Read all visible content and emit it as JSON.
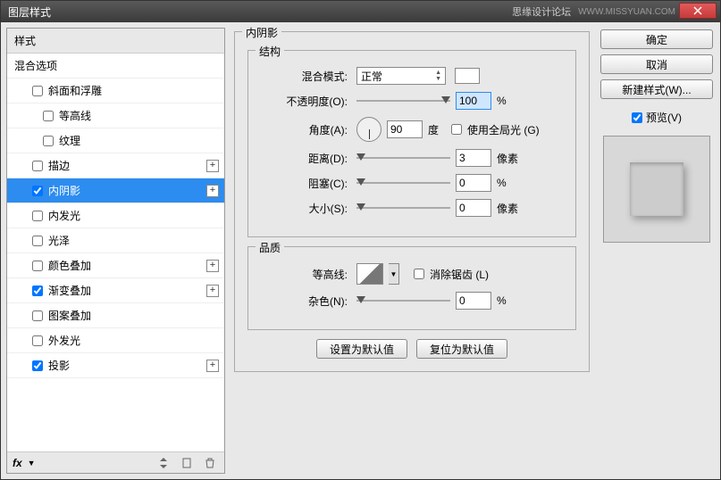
{
  "window": {
    "title": "图层样式",
    "brand": "思缘设计论坛",
    "url": "WWW.MISSYUAN.COM"
  },
  "styles": {
    "header": "样式",
    "blendOptions": "混合选项",
    "bevelEmboss": "斜面和浮雕",
    "contour": "等高线",
    "texture": "纹理",
    "stroke": "描边",
    "innerShadow": "内阴影",
    "innerGlow": "内发光",
    "satin": "光泽",
    "colorOverlay": "颜色叠加",
    "gradientOverlay": "渐变叠加",
    "patternOverlay": "图案叠加",
    "outerGlow": "外发光",
    "dropShadow": "投影"
  },
  "panel": {
    "title": "内阴影",
    "structure": "结构",
    "blendMode": "混合模式:",
    "blendModeValue": "正常",
    "opacity": "不透明度(O):",
    "opacityValue": "100",
    "opacityUnit": "%",
    "angle": "角度(A):",
    "angleValue": "90",
    "angleUnit": "度",
    "useGlobal": "使用全局光 (G)",
    "distance": "距离(D):",
    "distanceValue": "3",
    "distanceUnit": "像素",
    "choke": "阻塞(C):",
    "chokeValue": "0",
    "chokeUnit": "%",
    "size": "大小(S):",
    "sizeValue": "0",
    "sizeUnit": "像素",
    "quality": "品质",
    "contourLabel": "等高线:",
    "antiAlias": "消除锯齿 (L)",
    "noise": "杂色(N):",
    "noiseValue": "0",
    "noiseUnit": "%",
    "setDefault": "设置为默认值",
    "resetDefault": "复位为默认值"
  },
  "buttons": {
    "ok": "确定",
    "cancel": "取消",
    "newStyle": "新建样式(W)...",
    "preview": "预览(V)"
  },
  "footer": {
    "fx": "fx"
  }
}
